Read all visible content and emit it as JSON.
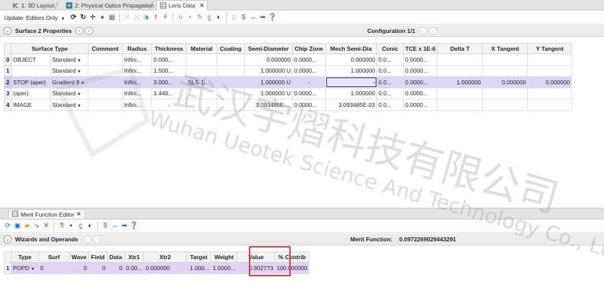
{
  "tabs": [
    {
      "label": "1: 3D Layout",
      "icon": "3d-layout-icon"
    },
    {
      "label": "2: Physical Optics Propagation",
      "icon": "pop-icon"
    },
    {
      "label": "Lens Data",
      "icon": "lens-data-icon",
      "close": "✕"
    }
  ],
  "toolbar": {
    "update_label": "Update: Editors Only"
  },
  "surface_bar": {
    "label": "Surface  2 Properties",
    "config": "Configuration 1/1"
  },
  "lde": {
    "columns": [
      "Surface Type",
      "Comment",
      "Radius",
      "Thickness",
      "Material",
      "Coating",
      "Semi-Diameter",
      "Chip Zone",
      "Mech Semi-Dia",
      "Conic",
      "TCE x 1E-6",
      "Delta T",
      "X Tangent",
      "Y Tangent"
    ],
    "rows": [
      {
        "num": "0",
        "name": "OBJECT",
        "type": "Standard",
        "comment": "",
        "radius": "Infini...",
        "thickness": "0.000...",
        "material": "",
        "coating": "",
        "semi": "0.000000",
        "semi_solve": "",
        "chip": "0.0000...",
        "mech": "0.000000",
        "conic": "0.0...",
        "tce": "0.0000...",
        "delta": "",
        "xtan": "",
        "ytan": ""
      },
      {
        "num": "1",
        "name": "",
        "type": "Standard",
        "comment": "",
        "radius": "Infini...",
        "thickness": "1.500...",
        "material": "",
        "coating": "",
        "semi": "1.000000",
        "semi_solve": "U",
        "chip": "0.0000...",
        "mech": "1.000000",
        "conic": "0.0...",
        "tce": "0.0000...",
        "delta": "",
        "xtan": "",
        "ytan": ""
      },
      {
        "num": "2",
        "name": "STOP (aper)",
        "type": "Gradient 9",
        "comment": "",
        "radius": "Infini...",
        "thickness": "3.000...",
        "material": "SLS-1...",
        "coating": "",
        "semi": "1.000000",
        "semi_solve": "U",
        "chip": "-",
        "mech": "-",
        "conic": "0.0...",
        "tce": "0.0000...",
        "delta": "1.000000",
        "xtan": "0.000000",
        "ytan": "0.000000"
      },
      {
        "num": "3",
        "name": "(aper)",
        "type": "Standard",
        "comment": "",
        "radius": "Infini...",
        "thickness": "1.440...",
        "material": "",
        "coating": "",
        "semi": "1.000000",
        "semi_solve": "U",
        "chip": "0.0000...",
        "mech": "1.000000",
        "conic": "0.0...",
        "tce": "0.0000...",
        "delta": "",
        "xtan": "",
        "ytan": ""
      },
      {
        "num": "4",
        "name": "IMAGE",
        "type": "Standard",
        "comment": "",
        "radius": "Infini...",
        "thickness": "-",
        "material": "",
        "coating": "",
        "semi": "3.093485E-...",
        "semi_solve": "",
        "chip": "0.0000...",
        "mech": "3.093485E-03",
        "conic": "0.0...",
        "tce": "0.0000...",
        "delta": "",
        "xtan": "",
        "ytan": ""
      }
    ]
  },
  "mfe": {
    "tab_label": "Merit Function Editor",
    "close": "✕",
    "wizards_label": "Wizards and Operands",
    "merit_label": "Merit Function:",
    "merit_value": "0.0972269029443291",
    "columns": [
      "Type",
      "Surf",
      "Wave",
      "Field",
      "Data",
      "Xtr1",
      "Xtr2",
      "Target",
      "Weight",
      "Value",
      "% Contrib"
    ],
    "rows": [
      {
        "num": "1",
        "type": "POPD",
        "surf": "0",
        "wave": "0",
        "field": "0",
        "data": "0",
        "xtr1": "0.00...",
        "xtr2": "0.000000",
        "target": "1.000...",
        "weight": "1.0000...",
        "value": "0.902773",
        "contrib": "100.000000"
      }
    ]
  },
  "watermark": {
    "cn": "武汉宇熠科技有限公司",
    "en": "Wuhan Ueotek Science And Technology Co., Ltd"
  },
  "colors": {
    "selected_row": "#d9d6f6",
    "operand_row": "#e2d3f5",
    "highlight_box": "#d23b3b"
  }
}
